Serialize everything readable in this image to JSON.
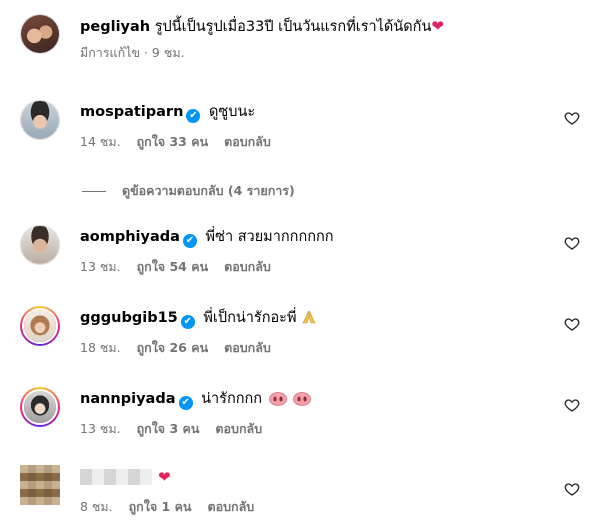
{
  "caption": {
    "username": "pegliyah",
    "text": "รูปนี้เป็นรูปเมื่อ33ปี เป็นวันแรกที่เราได้นัดกัน",
    "emoji": "heart-emoji",
    "meta": "มีการแก้ไข · 9 ชม."
  },
  "comments": [
    {
      "username": "mospatiparn",
      "verified": true,
      "text": "ดูซูบนะ",
      "time": "14 ชม.",
      "likes": "ถูกใจ 33 คน",
      "reply": "ตอบกลับ",
      "avatar_ring": false
    },
    {
      "username": "aomphiyada",
      "verified": true,
      "text": "พี่ซ่า สวยมากกกกกก",
      "time": "13 ชม.",
      "likes": "ถูกใจ 54 คน",
      "reply": "ตอบกลับ",
      "avatar_ring": false
    },
    {
      "username": "gggubgib15",
      "verified": true,
      "text": "พี่เป็กน่ารักอะพี่",
      "emoji": "folded-hands-emoji",
      "time": "18 ชม.",
      "likes": "ถูกใจ 26 คน",
      "reply": "ตอบกลับ",
      "avatar_ring": true
    },
    {
      "username": "nannpiyada",
      "verified": true,
      "text": "น่ารักกกก",
      "emoji": "pig-nose-emoji x2",
      "time": "13 ชม.",
      "likes": "ถูกใจ 3 คน",
      "reply": "ตอบกลับ",
      "avatar_ring": true
    },
    {
      "username": "",
      "verified": false,
      "text": "",
      "emoji": "heart-emoji",
      "time": "8 ชม.",
      "likes": "ถูกใจ 1 คน",
      "reply": "ตอบกลับ",
      "avatar_ring": false
    }
  ],
  "view_replies": "ดูข้อความตอบกลับ (4 รายการ)",
  "colors": {
    "verified": "#0095f6",
    "meta": "#737373",
    "heart": "#e0245e"
  }
}
